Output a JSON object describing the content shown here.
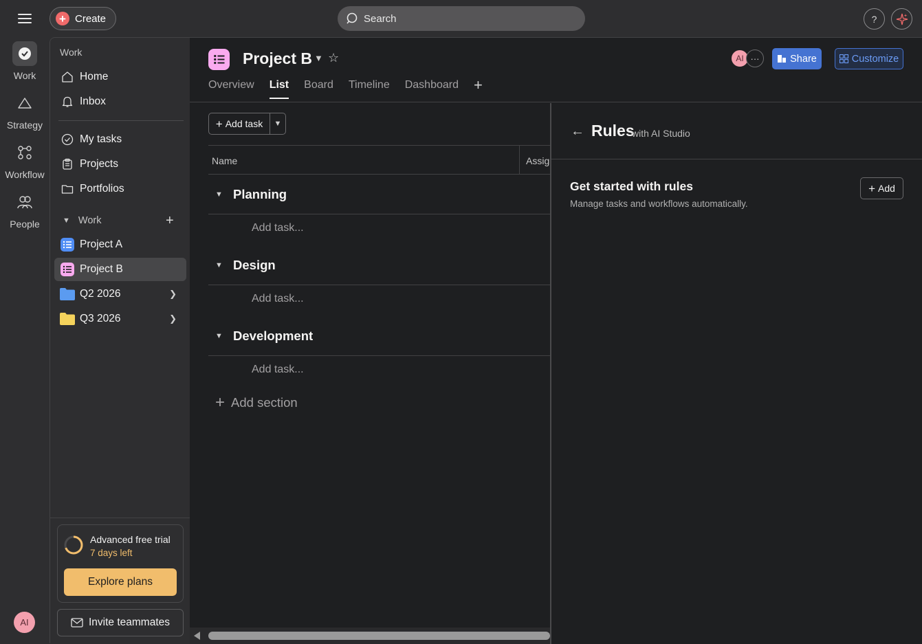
{
  "topbar": {
    "create_label": "Create",
    "search_placeholder": "Search",
    "help_label": "?"
  },
  "rail": {
    "items": [
      {
        "label": "Work",
        "icon": "check-circle-icon"
      },
      {
        "label": "Strategy",
        "icon": "triangle-icon"
      },
      {
        "label": "Workflow",
        "icon": "workflow-icon"
      },
      {
        "label": "People",
        "icon": "people-icon"
      }
    ],
    "avatar_initials": "AI"
  },
  "sidebar": {
    "heading": "Work",
    "nav": [
      {
        "label": "Home",
        "icon": "home-icon"
      },
      {
        "label": "Inbox",
        "icon": "bell-icon"
      }
    ],
    "nav2": [
      {
        "label": "My tasks",
        "icon": "check-circle-icon"
      },
      {
        "label": "Projects",
        "icon": "clipboard-icon"
      },
      {
        "label": "Portfolios",
        "icon": "folder-outline-icon"
      }
    ],
    "work_section": "Work",
    "projects": [
      {
        "label": "Project A",
        "color": "#4f8df5"
      },
      {
        "label": "Project B",
        "color": "#f9aaef"
      }
    ],
    "folders": [
      {
        "label": "Q2 2026",
        "color": "#5b9bf0"
      },
      {
        "label": "Q3 2026",
        "color": "#f5d35c"
      }
    ],
    "trial": {
      "title": "Advanced free trial",
      "days_left": "7 days left",
      "cta": "Explore plans"
    },
    "invite_label": "Invite teammates"
  },
  "project": {
    "title": "Project B",
    "tabs": [
      "Overview",
      "List",
      "Board",
      "Timeline",
      "Dashboard"
    ],
    "active_tab": "List",
    "member_initials": "AI",
    "more_label": "···",
    "share_label": "Share",
    "customize_label": "Customize"
  },
  "list": {
    "add_task_label": "Add task",
    "columns": [
      "Name",
      "Assignee"
    ],
    "sections": [
      {
        "title": "Planning",
        "add_task": "Add task..."
      },
      {
        "title": "Design",
        "add_task": "Add task..."
      },
      {
        "title": "Development",
        "add_task": "Add task..."
      }
    ],
    "add_section_label": "Add section"
  },
  "rules": {
    "title": "Rules",
    "subtitle": "with AI Studio",
    "get_started_title": "Get started with rules",
    "get_started_sub": "Manage tasks and workflows automatically.",
    "add_label": "Add"
  },
  "colors": {
    "accent_blue": "#4573d2",
    "trial_orange": "#f1bd6c",
    "create_red": "#f06a6a"
  }
}
